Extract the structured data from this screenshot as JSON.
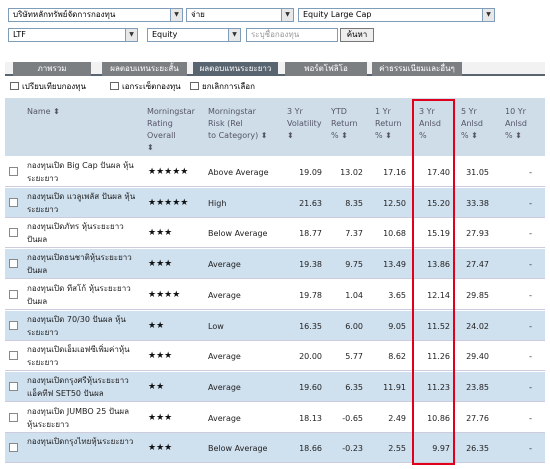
{
  "filters": {
    "company": "บริษัทหลักทรัพย์จัดการกองทุน",
    "type": "จ่าย",
    "category": "Equity Large Cap",
    "fund_type": "LTF",
    "asset": "Equity",
    "search_placeholder": "ระบุชื่อกองทุน",
    "search_button": "ค้นหา"
  },
  "tabs": [
    {
      "label": "ภาพรวม"
    },
    {
      "label": "ผลตอบแทนระยะสั้น"
    },
    {
      "label": "ผลตอบแทนระยะยาว"
    },
    {
      "label": "พอร์ตโฟลิโอ"
    },
    {
      "label": "ค่าธรรมเนียมและอื่นๆ"
    }
  ],
  "toolbar": {
    "compare": "เปรียบเทียบกองทุน",
    "portfolio": "เอกระเซ็ตกองทุน",
    "clear": "ยกเลิกการเลือก"
  },
  "columns": {
    "name": "Name ⬍",
    "rating": "Morningstar\nRating\nOverall\n⬍",
    "risk": "Morningstar\nRisk (Rel\nto Category) ⬍",
    "vol": "3 Yr\nVolatility\n⬍",
    "ytd": "YTD\nReturn\n% ⬍",
    "r1": "1 Yr\nReturn\n% ⬍",
    "r3": "3 Yr\nAnlsd\n%",
    "r5": "5 Yr\nAnlsd\n% ⬍",
    "r10": "10 Yr\nAnlsd\n% ⬍"
  },
  "rows": [
    {
      "name": "กองทุนเปิด Big Cap ปันผล หุ้นระยะยาว",
      "stars": "★★★★★",
      "risk": "Above Average",
      "vol": "19.09",
      "ytd": "13.02",
      "r1": "17.16",
      "r3": "17.40",
      "r5": "31.05",
      "r10": "-"
    },
    {
      "name": "กองทุนเปิด แวลูเพลัส ปันผล หุ้นระยะยาว",
      "stars": "★★★★★",
      "risk": "High",
      "vol": "21.63",
      "ytd": "8.35",
      "r1": "12.50",
      "r3": "15.20",
      "r5": "33.38",
      "r10": "-"
    },
    {
      "name": "กองทุนเปิดภัทร หุ้นระยะยาวปันผล",
      "stars": "★★★",
      "risk": "Below Average",
      "vol": "18.77",
      "ytd": "7.37",
      "r1": "10.68",
      "r3": "15.19",
      "r5": "27.93",
      "r10": "-"
    },
    {
      "name": "กองทุนเปิดธนชาติหุ้นระยะยาว ปันผล",
      "stars": "★★★",
      "risk": "Average",
      "vol": "19.38",
      "ytd": "9.75",
      "r1": "13.49",
      "r3": "13.86",
      "r5": "27.47",
      "r10": "-"
    },
    {
      "name": "กองทุนเปิด ทีสโก้ หุ้นระยะยาว ปันผล",
      "stars": "★★★★",
      "risk": "Average",
      "vol": "19.78",
      "ytd": "1.04",
      "r1": "3.65",
      "r3": "12.14",
      "r5": "29.85",
      "r10": "-"
    },
    {
      "name": "กองทุนเปิด 70/30 ปันผล หุ้นระยะยาว",
      "stars": "★★",
      "risk": "Low",
      "vol": "16.35",
      "ytd": "6.00",
      "r1": "9.05",
      "r3": "11.52",
      "r5": "24.02",
      "r10": "-"
    },
    {
      "name": "กองทุนเปิดเอ็มเอฟซีเพิ่มค่าหุ้นระยะยาว",
      "stars": "★★★",
      "risk": "Average",
      "vol": "20.00",
      "ytd": "5.77",
      "r1": "8.62",
      "r3": "11.26",
      "r5": "29.40",
      "r10": "-"
    },
    {
      "name": "กองทุนเปิดกรุงศรีหุ้นระยะยาว แอ็คทีฟ SET50 ปันผล",
      "stars": "★★",
      "risk": "Average",
      "vol": "19.60",
      "ytd": "6.35",
      "r1": "11.91",
      "r3": "11.23",
      "r5": "23.85",
      "r10": "-"
    },
    {
      "name": "กองทุนเปิด JUMBO 25 ปันผล หุ้นระยะยาว",
      "stars": "★★★",
      "risk": "Average",
      "vol": "18.13",
      "ytd": "-0.65",
      "r1": "2.49",
      "r3": "10.86",
      "r5": "27.76",
      "r10": "-"
    },
    {
      "name": "กองทุนเปิดกรุงไทยหุ้นระยะยาว",
      "stars": "★★★",
      "risk": "Below Average",
      "vol": "18.66",
      "ytd": "-0.23",
      "r1": "2.55",
      "r3": "9.97",
      "r5": "26.35",
      "r10": "-"
    }
  ],
  "colors": {
    "highlight": "#e0001b",
    "header_bg": "#cfdde9",
    "row_alt": "#cfe0ef",
    "tab_active": "#58646f"
  }
}
